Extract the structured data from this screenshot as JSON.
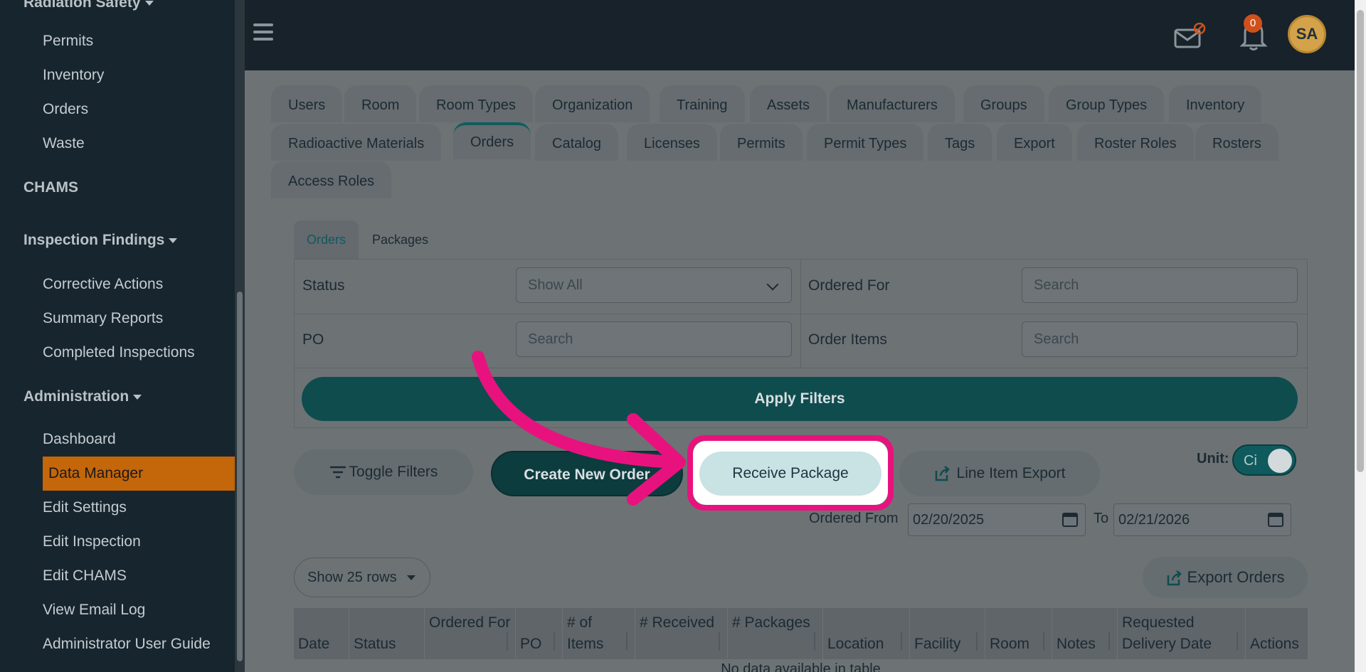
{
  "sidebar": {
    "top_section": "Radiation Safety",
    "items_rad": [
      "Permits",
      "Inventory",
      "Orders",
      "Waste"
    ],
    "chams": "CHAMS",
    "inspection_section": "Inspection Findings",
    "items_insp": [
      "Corrective Actions",
      "Summary Reports",
      "Completed Inspections"
    ],
    "admin_section": "Administration",
    "items_admin": [
      "Dashboard",
      "Data Manager",
      "Edit Settings",
      "Edit Inspection",
      "Edit CHAMS",
      "View Email Log",
      "Administrator User Guide"
    ],
    "active_item": "Data Manager"
  },
  "topbar": {
    "notification_count": "0",
    "avatar_initials": "SA"
  },
  "tabs": {
    "row1": [
      "Users",
      "Room",
      "Room Types",
      "Organization",
      "Training",
      "Assets",
      "Manufacturers",
      "Groups",
      "Group Types",
      "Inventory"
    ],
    "row2": [
      "Radioactive Materials",
      "Orders",
      "Catalog",
      "Licenses",
      "Permits",
      "Permit Types",
      "Tags",
      "Export",
      "Roster Roles",
      "Rosters"
    ],
    "row3": [
      "Access Roles"
    ],
    "active": "Orders"
  },
  "subtabs": [
    "Orders",
    "Packages"
  ],
  "filters": {
    "status_label": "Status",
    "status_value": "Show All",
    "ordered_for_label": "Ordered For",
    "ordered_for_placeholder": "Search",
    "po_label": "PO",
    "po_placeholder": "Search",
    "order_items_label": "Order Items",
    "order_items_placeholder": "Search",
    "apply": "Apply Filters"
  },
  "actions": {
    "toggle_filters": "Toggle Filters",
    "create_new_order": "Create New Order",
    "receive_package": "Receive Package",
    "line_item_export": "Line Item Export",
    "unit_label": "Unit:",
    "unit_value": "Ci"
  },
  "dates": {
    "from_label": "Ordered From",
    "from_value": "02/20/2025",
    "to_label": "To",
    "to_value": "02/21/2026"
  },
  "table": {
    "rows_select": "Show 25 rows",
    "export_orders": "Export Orders",
    "columns": [
      "Date",
      "Status",
      "Ordered For",
      "PO",
      "# of Items",
      "# Received",
      "# Packages",
      "Location",
      "Facility",
      "Room",
      "Notes",
      "Requested Delivery Date",
      "Actions"
    ],
    "empty_message": "No data available in table"
  },
  "colors": {
    "highlight": "#e8127e",
    "accent": "#0f5a5d",
    "active_nav": "#c4660a"
  }
}
